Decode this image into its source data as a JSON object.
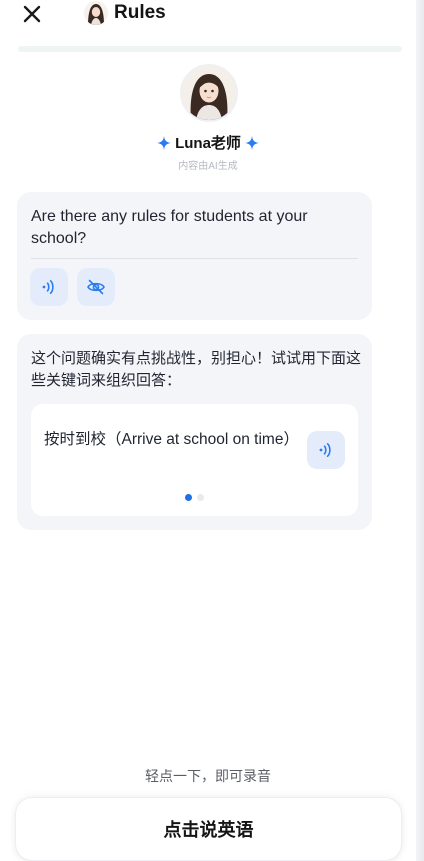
{
  "header": {
    "title": "Rules",
    "close_icon": "close-icon"
  },
  "tutor": {
    "name": "Luna老师",
    "ai_note": "内容由AI生成"
  },
  "question": {
    "text": "Are there any rules for students at your school?",
    "speak_icon": "speaker-icon",
    "hide_icon": "eye-off-icon"
  },
  "hint": {
    "text": "这个问题确实有点挑战性，别担心！试试用下面这些关键词来组织回答：",
    "keyword": "按时到校（Arrive at school on time）",
    "page_index": 1,
    "page_count": 2
  },
  "bottom": {
    "tap_hint": "轻点一下，即可录音",
    "record_label": "点击说英语"
  },
  "colors": {
    "accent": "#1e6fe8",
    "card_bg": "#f4f5f8",
    "icon_btn_bg": "#e4ecfb"
  }
}
